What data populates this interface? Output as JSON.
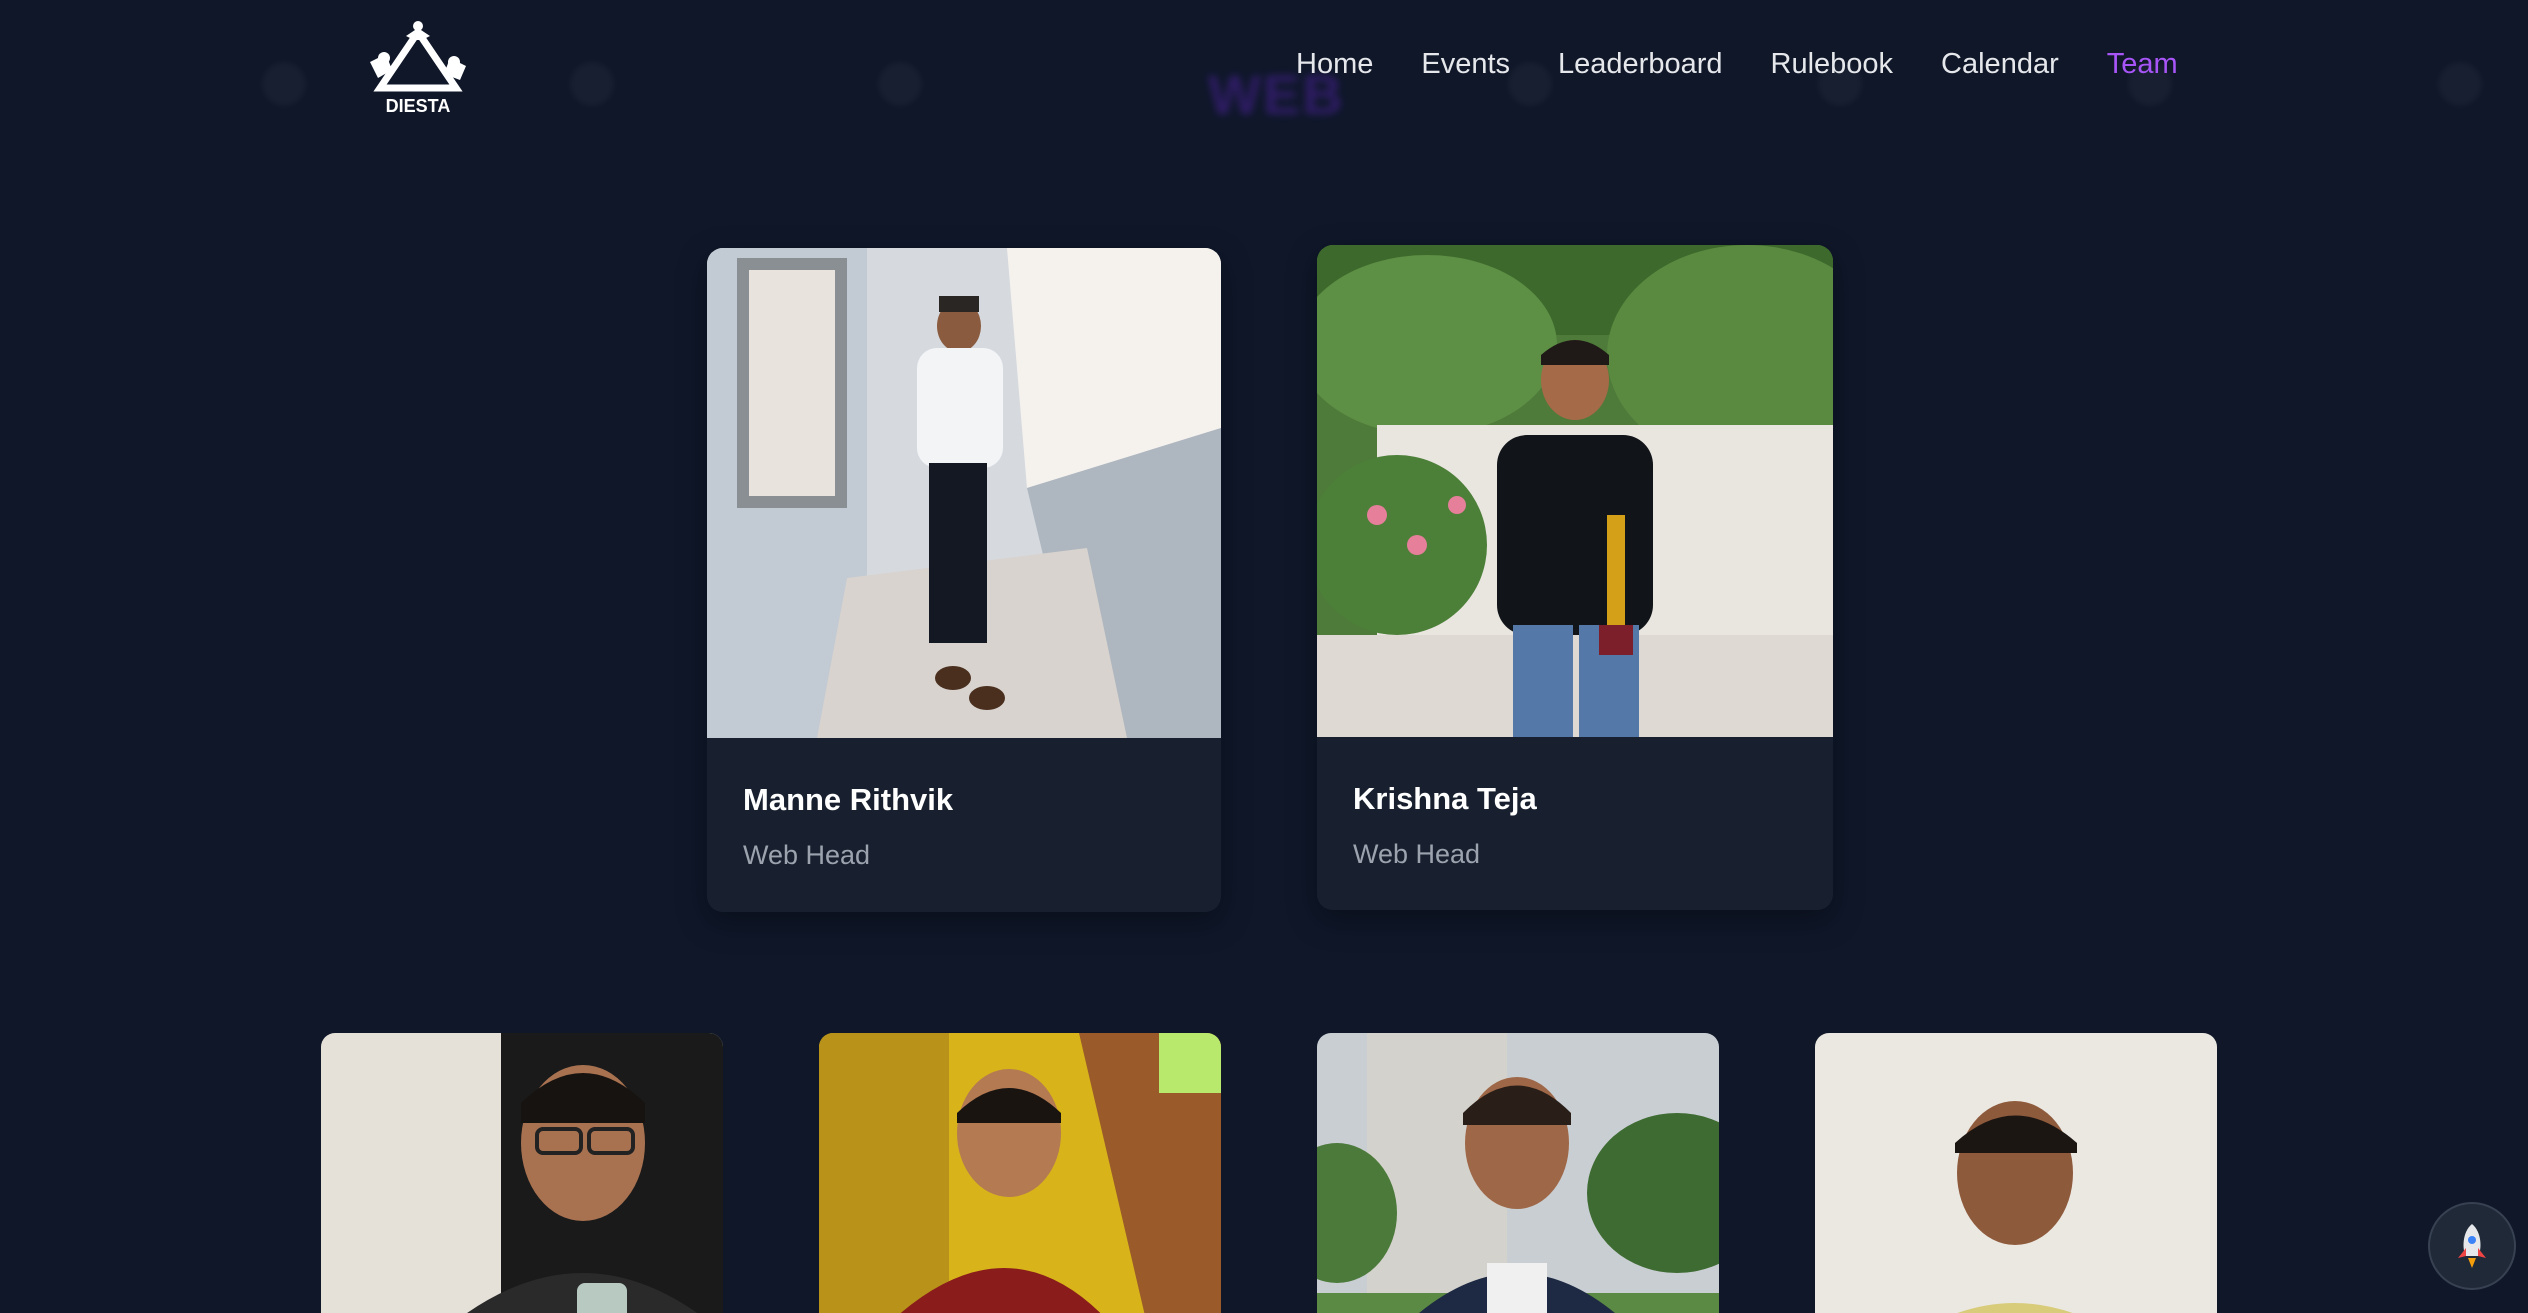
{
  "header": {
    "logo_text": "DIESTA",
    "nav": [
      {
        "label": "Home",
        "active": false
      },
      {
        "label": "Events",
        "active": false
      },
      {
        "label": "Leaderboard",
        "active": false
      },
      {
        "label": "Rulebook",
        "active": false
      },
      {
        "label": "Calendar",
        "active": false
      },
      {
        "label": "Team",
        "active": true
      }
    ]
  },
  "background": {
    "faint_word": "WEB"
  },
  "team": {
    "heads": [
      {
        "name": "Manne Rithvik",
        "role": "Web Head"
      },
      {
        "name": "Krishna Teja",
        "role": "Web Head"
      }
    ],
    "members_visible": 4
  },
  "colors": {
    "background": "#0f1729",
    "accent": "#a855f7",
    "card": "#18202f"
  },
  "icons": {
    "scroll_top": "rocket-icon"
  }
}
